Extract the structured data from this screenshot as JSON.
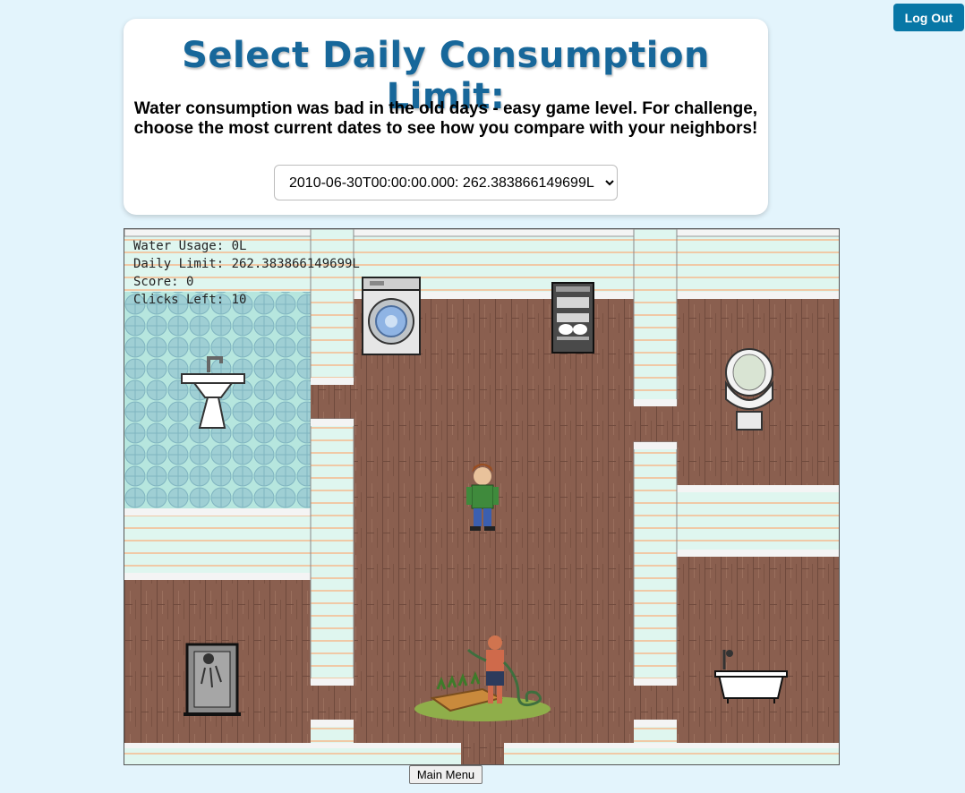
{
  "header": {
    "logout_label": "Log Out"
  },
  "card": {
    "title": "Select Daily Consumption Limit:",
    "subtitle_line1": "Water consumption was bad in the old days - easy game level. For challenge,",
    "subtitle_line2": "choose the most current dates to see how you compare with your neighbors!",
    "select_value": "2010-06-30T00:00:00.000: 262.383866149699L"
  },
  "hud": {
    "water_usage": "Water Usage: 0L",
    "daily_limit": "Daily Limit: 262.383866149699L",
    "score": "Score: 0",
    "clicks_left": "Clicks Left: 10"
  },
  "game": {
    "items": [
      "sink",
      "washing-machine",
      "dishwasher",
      "toilet",
      "shower",
      "bathtub",
      "garden-hose",
      "player"
    ]
  },
  "footer": {
    "main_menu_label": "Main Menu"
  },
  "colors": {
    "accent": "#0877a6",
    "title": "#17679a",
    "floor": "#8a5f4f",
    "wall": "#dff6ef",
    "tile": "#a7dcd6"
  }
}
